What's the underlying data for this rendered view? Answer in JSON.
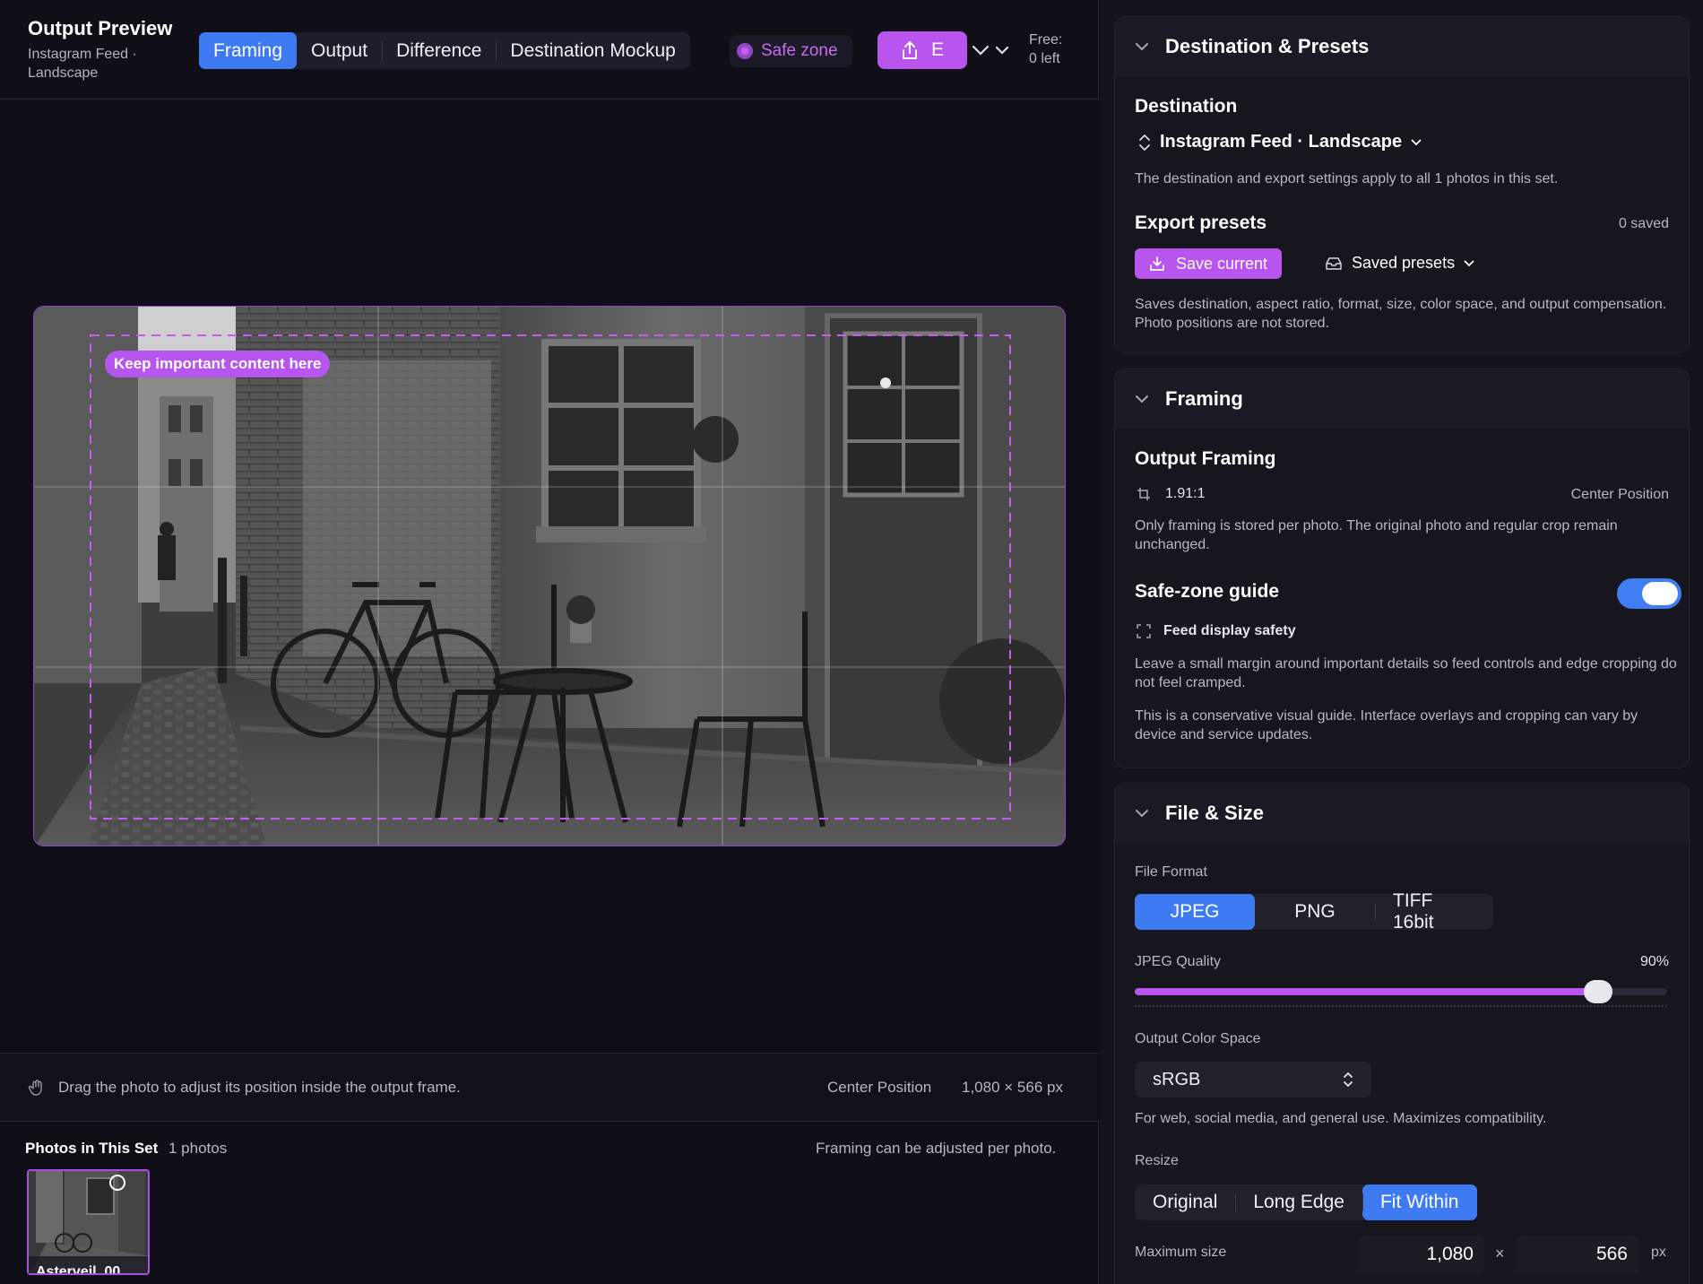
{
  "header": {
    "title": "Output Preview",
    "subtitle": "Instagram Feed · Landscape",
    "tabs": [
      "Framing",
      "Output",
      "Difference",
      "Destination Mockup"
    ],
    "active_tab": "Framing",
    "safe_zone_label": "Safe zone",
    "export_label": "E",
    "free_label": "Free:",
    "free_value": "0 left"
  },
  "preview": {
    "safe_zone_badge": "Keep important content here"
  },
  "status_bar": {
    "hint": "Drag the photo to adjust its position inside the output frame.",
    "position": "Center Position",
    "dimensions": "1,080 × 566 px"
  },
  "photo_set": {
    "title": "Photos in This Set",
    "count": "1 photos",
    "note": "Framing can be adjusted per photo.",
    "thumbnails": [
      {
        "label": "Asterveil_00"
      }
    ]
  },
  "panel": {
    "destination_section": {
      "title": "Destination & Presets",
      "destination_label": "Destination",
      "destination_value": "Instagram Feed · Landscape",
      "destination_note": "The destination and export settings apply to all 1 photos in this set.",
      "presets_label": "Export presets",
      "presets_saved": "0 saved",
      "save_current": "Save current",
      "saved_presets": "Saved presets",
      "presets_note": "Saves destination, aspect ratio, format, size, color space, and output compensation. Photo positions are not stored."
    },
    "framing_section": {
      "title": "Framing",
      "output_framing_label": "Output Framing",
      "ratio": "1.91:1",
      "position": "Center Position",
      "framing_note": "Only framing is stored per photo. The original photo and regular crop remain unchanged.",
      "safe_zone_label": "Safe-zone guide",
      "safe_zone_on": true,
      "feed_safety": "Feed display safety",
      "feed_note": "Leave a small margin around important details so feed controls and edge cropping do not feel cramped.",
      "conservative_note": "This is a conservative visual guide. Interface overlays and cropping can vary by device and service updates."
    },
    "file_section": {
      "title": "File & Size",
      "format_label": "File Format",
      "formats": [
        "JPEG",
        "PNG",
        "TIFF 16bit"
      ],
      "active_format": "JPEG",
      "quality_label": "JPEG Quality",
      "quality_value": "90%",
      "quality_fraction": 0.9,
      "color_space_label": "Output Color Space",
      "color_space_value": "sRGB",
      "color_space_note": "For web, social media, and general use. Maximizes compatibility.",
      "resize_label": "Resize",
      "resize_options": [
        "Original",
        "Long Edge",
        "Fit Within"
      ],
      "active_resize": "Fit Within",
      "max_size_label": "Maximum size",
      "width": "1,080",
      "times": "×",
      "height": "566",
      "unit": "px"
    }
  },
  "colors": {
    "accent_purple": "#b955ee",
    "accent_blue": "#3e7bf3",
    "background": "#100f18"
  },
  "icons": [
    "share-icon",
    "chevron-down-icon",
    "hand-drag-icon",
    "updown-icon",
    "save-icon",
    "drawer-icon",
    "crop-icon",
    "frame-corners-icon",
    "safe-zone-dot-icon"
  ]
}
